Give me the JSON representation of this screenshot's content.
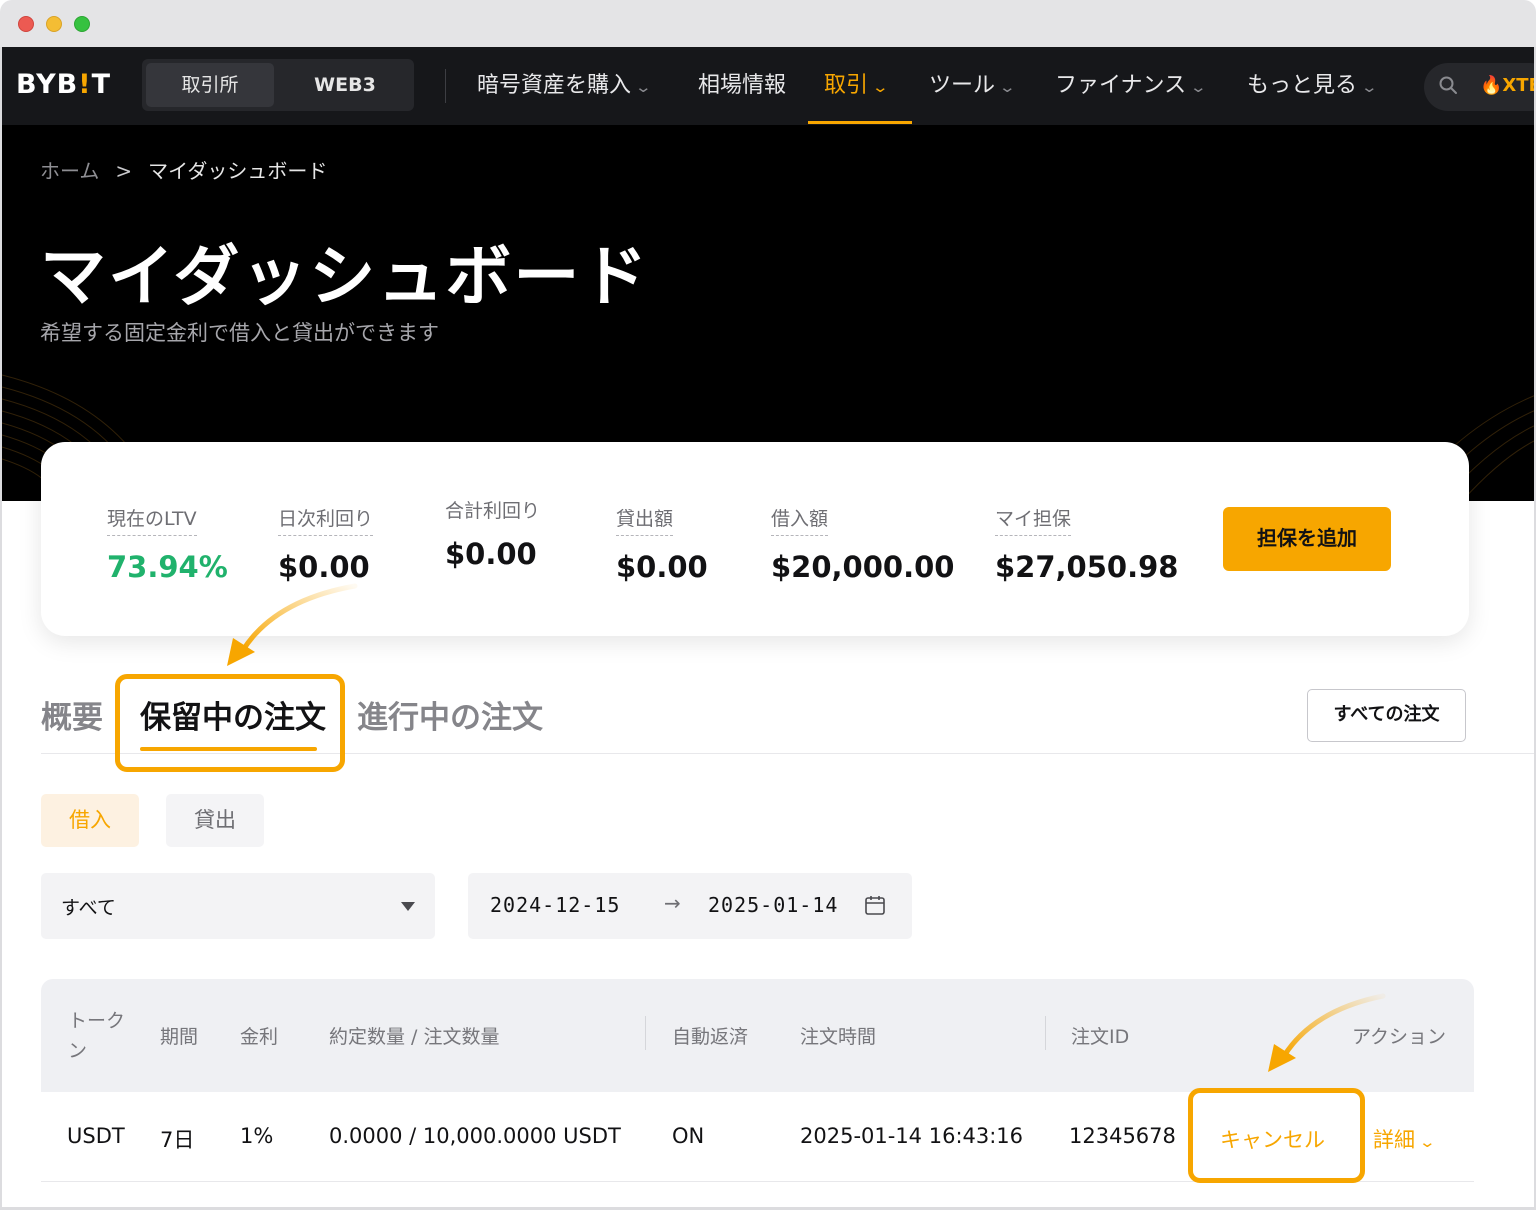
{
  "nav": {
    "logo_left": "BYB",
    "logo_bang": "!",
    "logo_right": "T",
    "seg_exchange": "取引所",
    "seg_web3": "WEB3",
    "items": [
      {
        "label": "暗号資産を購入",
        "chevron": "⌄"
      },
      {
        "label": "相場情報"
      },
      {
        "label": "取引",
        "chevron": "⌄",
        "active": true
      },
      {
        "label": "ツール",
        "chevron": "⌄"
      },
      {
        "label": "ファイナンス",
        "chevron": "⌄"
      },
      {
        "label": "もっと見る",
        "chevron": "⌄"
      }
    ],
    "search_tag": "🔥XTE",
    "accent_color": "#f7a600"
  },
  "breadcrumb": {
    "home": "ホーム",
    "separator": ">",
    "current": "マイダッシュボード"
  },
  "hero": {
    "title": "マイダッシュボード",
    "subtitle": "希望する固定金利で借入と貸出ができます"
  },
  "stats": {
    "ltv_label": "現在のLTV",
    "ltv_value": "73.94%",
    "daily_label": "日次利回り",
    "daily_value": "$0.00",
    "total_label": "合計利回り",
    "total_value": "$0.00",
    "lend_label": "貸出額",
    "lend_value": "$0.00",
    "borrow_label": "借入額",
    "borrow_value": "$20,000.00",
    "collateral_label": "マイ担保",
    "collateral_value": "$27,050.98",
    "add_collateral_button": "担保を追加"
  },
  "tabs": {
    "overview": "概要",
    "pending": "保留中の注文",
    "active": "進行中の注文",
    "all_orders_button": "すべての注文"
  },
  "toggle": {
    "borrow": "借入",
    "lend": "貸出"
  },
  "filters": {
    "status_value": "すべて",
    "date_from": "2024-12-15",
    "date_arrow": "→",
    "date_to": "2025-01-14"
  },
  "table": {
    "headers": {
      "token_line1": "トーク",
      "token_line2": "ン",
      "term": "期間",
      "rate": "金利",
      "qty": "約定数量 / 注文数量",
      "auto_repay": "自動返済",
      "order_time": "注文時間",
      "order_id": "注文ID",
      "action": "アクション"
    },
    "rows": [
      {
        "token": "USDT",
        "term": "7日",
        "rate": "1%",
        "qty": "0.0000 / 10,000.0000 USDT",
        "auto_repay": "ON",
        "order_time": "2025-01-14 16:43:16",
        "order_id": "12345678",
        "cancel": "キャンセル",
        "details": "詳細"
      }
    ]
  }
}
